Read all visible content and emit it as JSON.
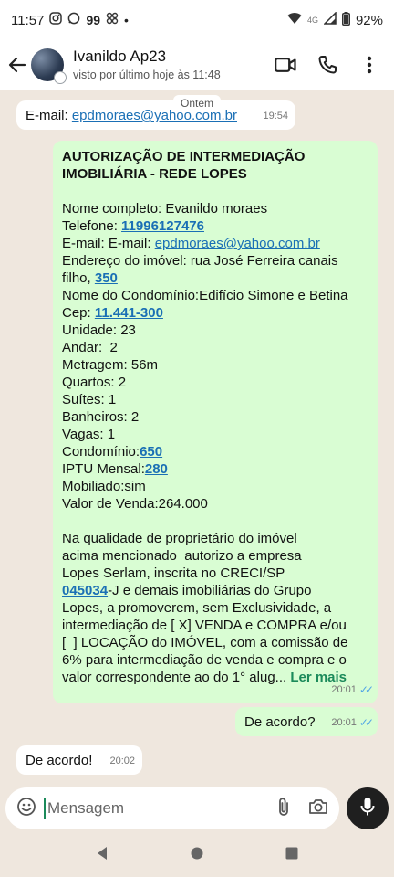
{
  "status_bar": {
    "time": "11:57",
    "notif_count": "99",
    "dot": "•",
    "network": "4G",
    "battery": "92%"
  },
  "header": {
    "contact_name": "Ivanildo Ap23",
    "last_seen": "visto por último hoje às 11:48"
  },
  "date_chip": "Ontem",
  "messages": {
    "m1": {
      "label": "E-mail: ",
      "email": "epdmoraes@yahoo.com.br",
      "time": "19:54"
    },
    "m2": {
      "title1": "AUTORIZAÇÃO DE INTERMEDIAÇÃO",
      "title2": "IMOBILIÁRIA - REDE LOPES",
      "l_nome": "Nome completo: Evanildo moraes",
      "l_tel_label": "Telefone: ",
      "l_tel_val": "11996127476",
      "l_email_label": "E-mail: E-mail: ",
      "l_email_val": "epdmoraes@yahoo.com.br",
      "l_end1": "Endereço do imóvel: rua José Ferreira canais",
      "l_end2": "filho, ",
      "l_end_num": "350",
      "l_cond_nome": "Nome do Condomínio:Edifício Simone e Betina",
      "l_cep_label": "Cep: ",
      "l_cep_val": "11.441-300",
      "l_unidade": "Unidade: 23",
      "l_andar": "Andar:  2",
      "l_metragem": "Metragem: 56m",
      "l_quartos": "Quartos: 2",
      "l_suites": "Suítes: 1",
      "l_banheiros": "Banheiros: 2",
      "l_vagas": "Vagas: 1",
      "l_condominio_label": "Condomínio:",
      "l_condominio_val": "650",
      "l_iptu_label": "IPTU Mensal:",
      "l_iptu_val": "280",
      "l_mobiliado": "Mobiliado:sim",
      "l_valor": "Valor de Venda:264.000",
      "p1": "Na qualidade de proprietário do imóvel",
      "p2": "acima mencionado  autorizo a empresa",
      "p3": "Lopes Serlam, inscrita no CRECI/SP",
      "p4_link": "045034",
      "p4_rest": "-J e demais imobiliárias do Grupo",
      "p5": "Lopes, a promoverem, sem Exclusividade, a",
      "p6": "intermediação de [ X] VENDA e COMPRA e/ou",
      "p7": "[  ] LOCAÇÃO do IMÓVEL, com a comissão de",
      "p8": "6% para intermediação de venda e compra e o",
      "p9": "valor correspondente ao do 1° alug... ",
      "read_more": "Ler mais",
      "time": "20:01"
    },
    "m3": {
      "text": "De acordo?",
      "time": "20:01"
    },
    "m4": {
      "text": "De acordo!",
      "time": "20:02"
    }
  },
  "composer": {
    "placeholder": "Mensagem"
  },
  "colors": {
    "chat_bg": "#efe7de",
    "outgoing_bubble": "#d9fdd3",
    "link": "#1a6fb5",
    "read_more": "#1b8a5a",
    "read_ticks": "#53a6e6"
  }
}
